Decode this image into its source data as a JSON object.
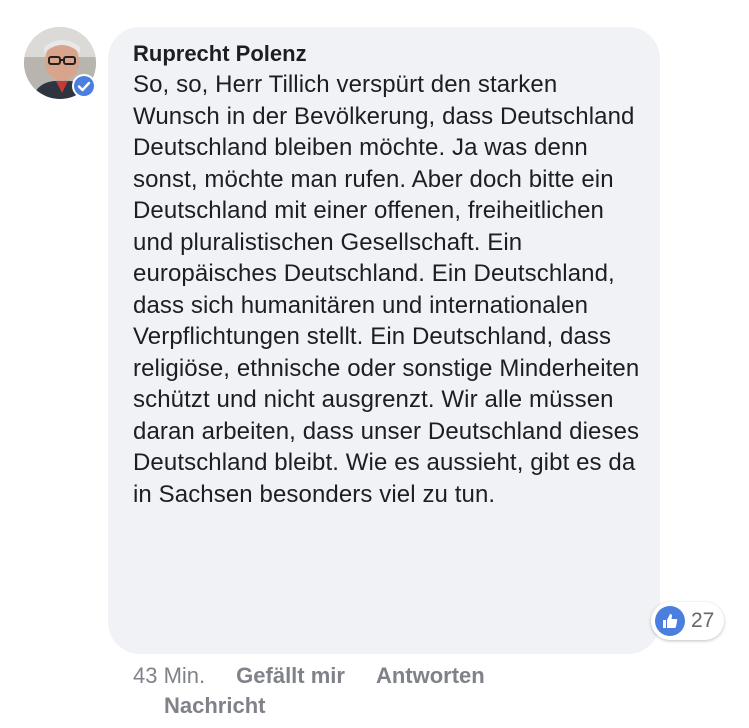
{
  "comment": {
    "author": "Ruprecht Polenz",
    "verified": true,
    "text": "So, so, Herr Tillich verspürt den starken Wunsch in der Bevölkerung, dass Deutschland Deutschland bleiben möchte. Ja was denn sonst, möchte man rufen. Aber doch bitte ein Deutschland mit einer offenen, freiheitlichen und pluralistischen Gesellschaft. Ein europäisches Deutschland. Ein Deutschland, dass sich humanitären und internationalen Verpflichtungen stellt. Ein Deutschland, dass religiöse, ethnische oder sonstige Minderheiten schützt und nicht ausgrenzt. Wir alle müssen daran arbeiten, dass unser Deutschland dieses Deutschland bleibt. Wie es aussieht, gibt es da in Sachsen besonders viel zu tun.",
    "reactions": {
      "icon": "like-icon",
      "count": "27"
    }
  },
  "actions": {
    "time": "43 Min.",
    "like_label": "Gefällt mir",
    "reply_label": "Antworten",
    "message_label": "Nachricht"
  },
  "colors": {
    "bubble_bg": "#f1f2f6",
    "text": "#1c1e21",
    "meta": "#7f8288",
    "like_blue": "#4a7fe0"
  }
}
